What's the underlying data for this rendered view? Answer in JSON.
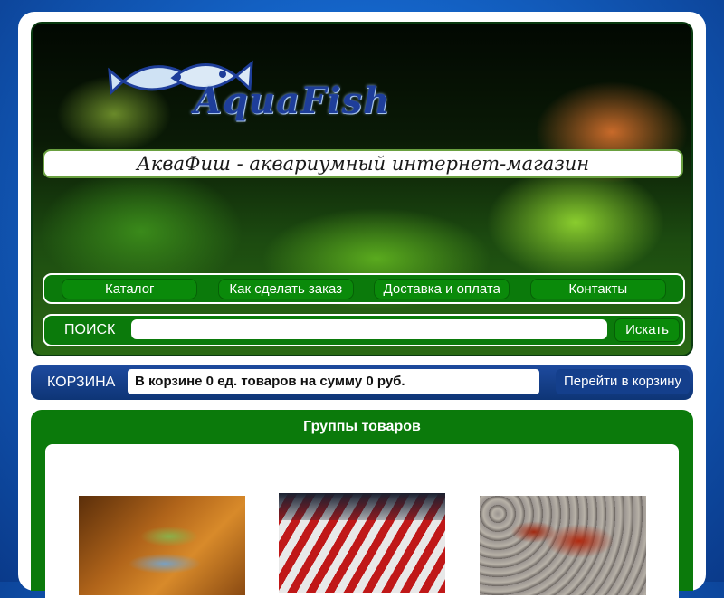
{
  "header": {
    "logo_text": "AquaFish",
    "site_title": "АкваФиш - аквариумный интернет-магазин"
  },
  "nav": {
    "items": [
      {
        "label": "Каталог"
      },
      {
        "label": "Как сделать заказ"
      },
      {
        "label": "Доставка и оплата"
      },
      {
        "label": "Контакты"
      }
    ]
  },
  "search": {
    "label": "ПОИСК",
    "value": "",
    "button": "Искать"
  },
  "cart": {
    "label": "КОРЗИНА",
    "status": "В корзине 0 ед. товаров на сумму 0 руб.",
    "button": "Перейти в корзину"
  },
  "groups": {
    "title": "Группы товаров",
    "items": [
      {
        "image": "fish-photo"
      },
      {
        "image": "shrimp-photo"
      },
      {
        "image": "crayfish-photo"
      }
    ]
  },
  "colors": {
    "green": "#0b7a0b",
    "blue": "#0e3576",
    "background": "#1464c8"
  }
}
